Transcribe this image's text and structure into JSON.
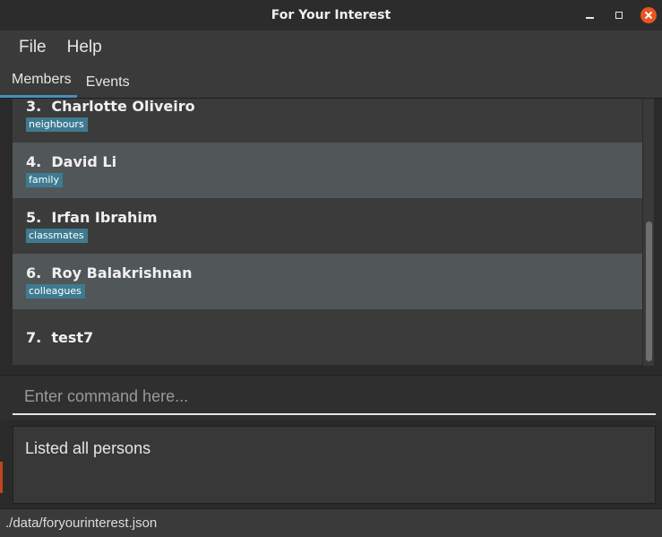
{
  "window": {
    "title": "For Your Interest"
  },
  "menu": {
    "items": [
      {
        "label": "File"
      },
      {
        "label": "Help"
      }
    ]
  },
  "tabs": [
    {
      "label": "Members",
      "active": true
    },
    {
      "label": "Events",
      "active": false
    }
  ],
  "members": [
    {
      "index": "3.",
      "name": "Charlotte Oliveiro",
      "tag": "neighbours"
    },
    {
      "index": "4.",
      "name": "David Li",
      "tag": "family"
    },
    {
      "index": "5.",
      "name": "Irfan Ibrahim",
      "tag": "classmates"
    },
    {
      "index": "6.",
      "name": "Roy Balakrishnan",
      "tag": "colleagues"
    },
    {
      "index": "7.",
      "name": "test7",
      "tag": ""
    }
  ],
  "command": {
    "placeholder": "Enter command here...",
    "value": ""
  },
  "result": {
    "text": "Listed all persons"
  },
  "status": {
    "path": "./data/foryourinterest.json"
  },
  "colors": {
    "tag": "#3e7b91",
    "tab_indicator": "#4a8ebd",
    "close_button": "#e95420"
  }
}
